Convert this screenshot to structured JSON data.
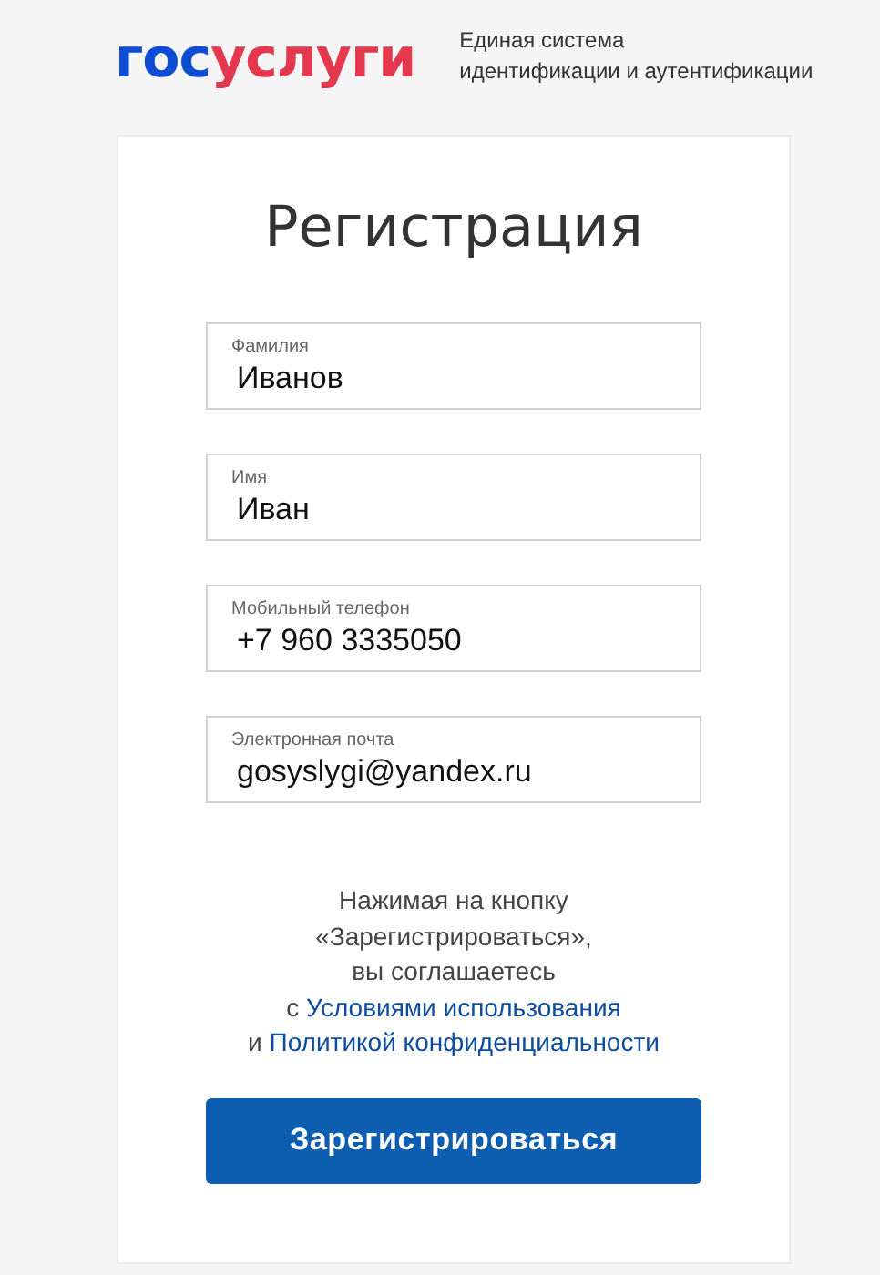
{
  "header": {
    "logo": {
      "part_1": "гос",
      "part_2": "услуги"
    },
    "tagline": [
      "Единая система",
      "идентификации и аутентификации"
    ]
  },
  "form": {
    "title": "Регистрация",
    "fields": [
      {
        "label": "Фамилия",
        "value": "Иванов"
      },
      {
        "label": "Имя",
        "value": "Иван"
      },
      {
        "label": "Мобильный телефон",
        "value": "+7 960 3335050"
      },
      {
        "label": "Электронная почта",
        "value": "gosyslygi@yandex.ru"
      }
    ],
    "agreement": {
      "lines": [
        "Нажимая на кнопку",
        "«Зарегистрироваться»,",
        "вы соглашаетесь"
      ],
      "terms_prefix": "с",
      "terms_link": "Условиями использования",
      "privacy_prefix": "и",
      "privacy_link": "Политикой конфиденциальности"
    },
    "submit": "Зарегистрироваться"
  }
}
